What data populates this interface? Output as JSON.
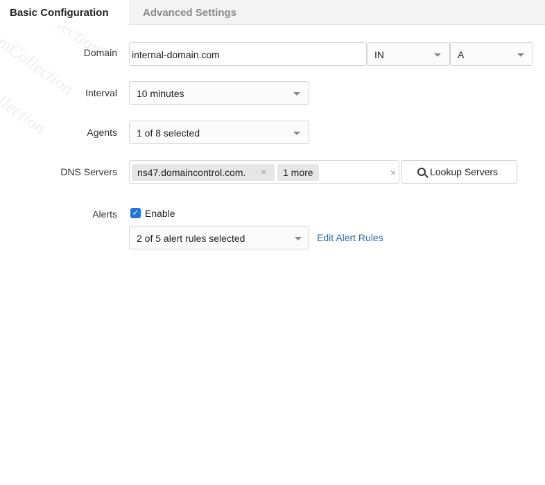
{
  "tabs": {
    "basic": "Basic Configuration",
    "advanced": "Advanced Settings"
  },
  "domain": {
    "label": "Domain",
    "value": "internal-domain.com",
    "class_select": "IN",
    "type_select": "A"
  },
  "interval": {
    "label": "Interval",
    "value": "10 minutes"
  },
  "agents": {
    "label": "Agents",
    "value": "1 of 8 selected"
  },
  "dns_servers": {
    "label": "DNS Servers",
    "tag": "ns47.domaincontrol.com.",
    "tag_remove": "×",
    "more": "1 more",
    "clear": "×",
    "lookup_button": "Lookup Servers"
  },
  "alerts": {
    "label": "Alerts",
    "enable_label": "Enable",
    "rules_value": "2 of 5 alert rules selected",
    "edit_link": "Edit Alert Rules"
  },
  "watermark": "MyExamCollection",
  "colors": {
    "accent": "#1e73e8",
    "link": "#2a6db0",
    "tab_inactive_bg": "#f3f3f3"
  }
}
